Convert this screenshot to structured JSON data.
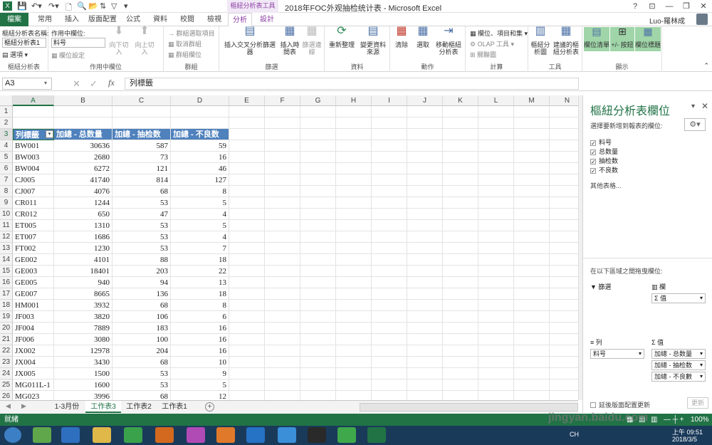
{
  "window": {
    "title": "2018年FOC外观抽检统计表 - Microsoft Excel",
    "context_title": "樞紐分析表工具",
    "user": "Luo-羅林成",
    "help": "?"
  },
  "tabs": [
    "檔案",
    "常用",
    "插入",
    "版面配置",
    "公式",
    "資料",
    "校閱",
    "檢視",
    "分析",
    "設計"
  ],
  "ribbon": {
    "pivot_name_label": "樞紐分析表名稱:",
    "pivot_name_value": "樞紐分析表1",
    "options_label": "選項",
    "active_field_label": "作用中欄位:",
    "active_field_value": "料号",
    "field_settings": "欄位設定",
    "drill_down": "向下切入",
    "drill_up": "向上切入",
    "group_selection": "群組選取項目",
    "ungroup": "取消群組",
    "group_field": "群組欄位",
    "slicer": "插入交叉分析篩選器",
    "timeline": "插入時間表",
    "filter_conn": "篩選連線",
    "refresh": "重新整理",
    "change_source": "變更資料來源",
    "clear": "清除",
    "select": "選取",
    "move": "移動樞紐分析表",
    "fields_items": "欄位、項目和集",
    "olap": "OLAP 工具",
    "relationships": "關聯圖",
    "pivotchart": "樞紐分析圖",
    "recommended": "建議的樞紐分析表",
    "field_list": "欄位清單",
    "buttons": "+/- 按鈕",
    "headers": "欄位標題",
    "groups": [
      "樞紐分析表",
      "作用中欄位",
      "群組",
      "篩選",
      "資料",
      "動作",
      "計算",
      "工具",
      "顯示"
    ]
  },
  "formula": {
    "namebox": "A3",
    "value": "列標籤",
    "fx": "fx"
  },
  "columns": [
    "A",
    "B",
    "C",
    "D",
    "E",
    "F",
    "G",
    "H",
    "I",
    "J",
    "K",
    "L",
    "M",
    "N"
  ],
  "header": [
    "列標籤",
    "加總 - 总数量",
    "加總 - 抽检数",
    "加總 - 不良数"
  ],
  "rows": [
    [
      "BW001",
      "30636",
      "587",
      "59"
    ],
    [
      "BW003",
      "2680",
      "73",
      "16"
    ],
    [
      "BW004",
      "6272",
      "121",
      "46"
    ],
    [
      "CJ005",
      "41740",
      "814",
      "127"
    ],
    [
      "CJ007",
      "4076",
      "68",
      "8"
    ],
    [
      "CR011",
      "1244",
      "53",
      "5"
    ],
    [
      "CR012",
      "650",
      "47",
      "4"
    ],
    [
      "ET005",
      "1310",
      "53",
      "5"
    ],
    [
      "ET007",
      "1686",
      "53",
      "4"
    ],
    [
      "FT002",
      "1230",
      "53",
      "7"
    ],
    [
      "GE002",
      "4101",
      "88",
      "18"
    ],
    [
      "GE003",
      "18401",
      "203",
      "22"
    ],
    [
      "GE005",
      "940",
      "94",
      "13"
    ],
    [
      "GE007",
      "8665",
      "136",
      "18"
    ],
    [
      "HM001",
      "3932",
      "68",
      "8"
    ],
    [
      "JF003",
      "3820",
      "106",
      "6"
    ],
    [
      "JF004",
      "7889",
      "183",
      "16"
    ],
    [
      "JF006",
      "3080",
      "100",
      "16"
    ],
    [
      "JX002",
      "12978",
      "204",
      "16"
    ],
    [
      "JX004",
      "3430",
      "68",
      "10"
    ],
    [
      "JX005",
      "1500",
      "53",
      "9"
    ],
    [
      "MG011L-1",
      "1600",
      "53",
      "5"
    ],
    [
      "MG023",
      "3996",
      "68",
      "12"
    ],
    [
      "MG046",
      "590",
      "47",
      "9"
    ]
  ],
  "pane": {
    "title": "樞紐分析表欄位",
    "subtitle": "選擇要新增到報表的欄位:",
    "fields": [
      "料号",
      "总数量",
      "抽检数",
      "不良数"
    ],
    "more": "其他表格...",
    "drag_label": "在以下區域之間拖曳欄位:",
    "filters": "篩選",
    "columns": "欄",
    "columns_item": "Σ 值",
    "rows": "列",
    "rows_item": "料号",
    "values": "Σ 值",
    "values_items": [
      "加總 - 总数量",
      "加總 - 抽检数",
      "加總 - 不良數"
    ],
    "defer": "延後版面配置更新",
    "update": "更新"
  },
  "sheets": [
    "1-3月份",
    "工作表3",
    "工作表2",
    "工作表1"
  ],
  "status": {
    "ready": "就緒",
    "zoom": "100%"
  },
  "taskbar": {
    "time": "上午 09:51",
    "date": "2018/3/5",
    "lang": "CH"
  },
  "watermark": "jingyan.baidu.com"
}
